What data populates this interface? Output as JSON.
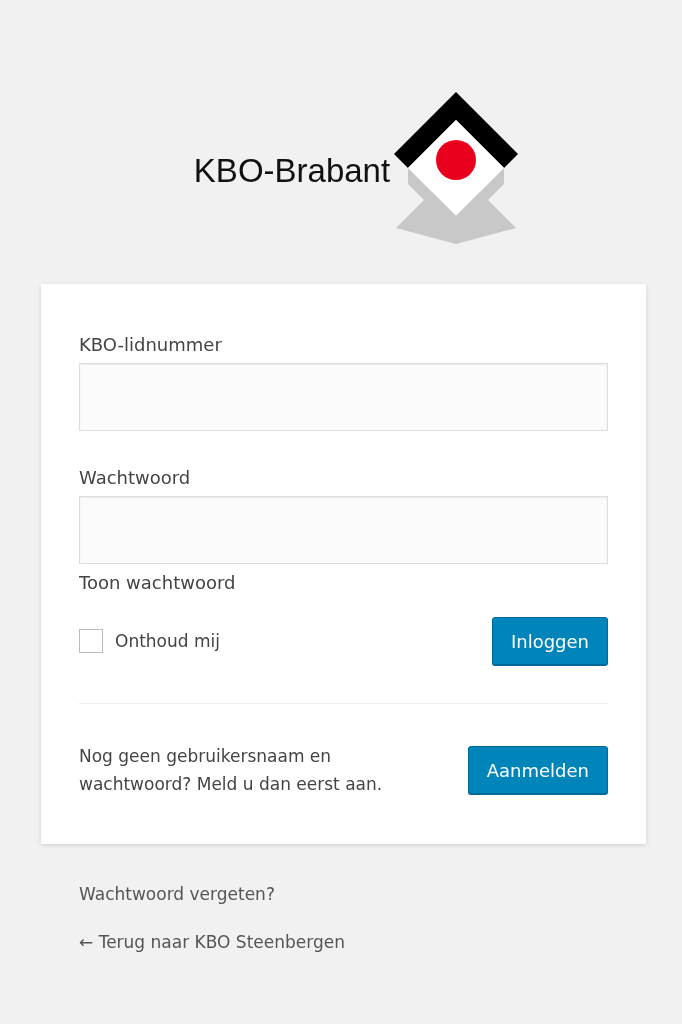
{
  "logo": {
    "text": "KBO-Brabant"
  },
  "form": {
    "username": {
      "label": "KBO-lidnummer"
    },
    "password": {
      "label": "Wachtwoord"
    },
    "show_password": "Toon wachtwoord",
    "remember": {
      "label": "Onthoud mij",
      "checked": false
    },
    "login_button": "Inloggen",
    "register_text": "Nog geen gebruikersnaam en wachtwoord? Meld u dan eerst aan.",
    "register_button": "Aanmelden"
  },
  "links": [
    {
      "label": "Wachtwoord vergeten?"
    },
    {
      "label": "← Terug naar KBO Steenbergen"
    }
  ]
}
